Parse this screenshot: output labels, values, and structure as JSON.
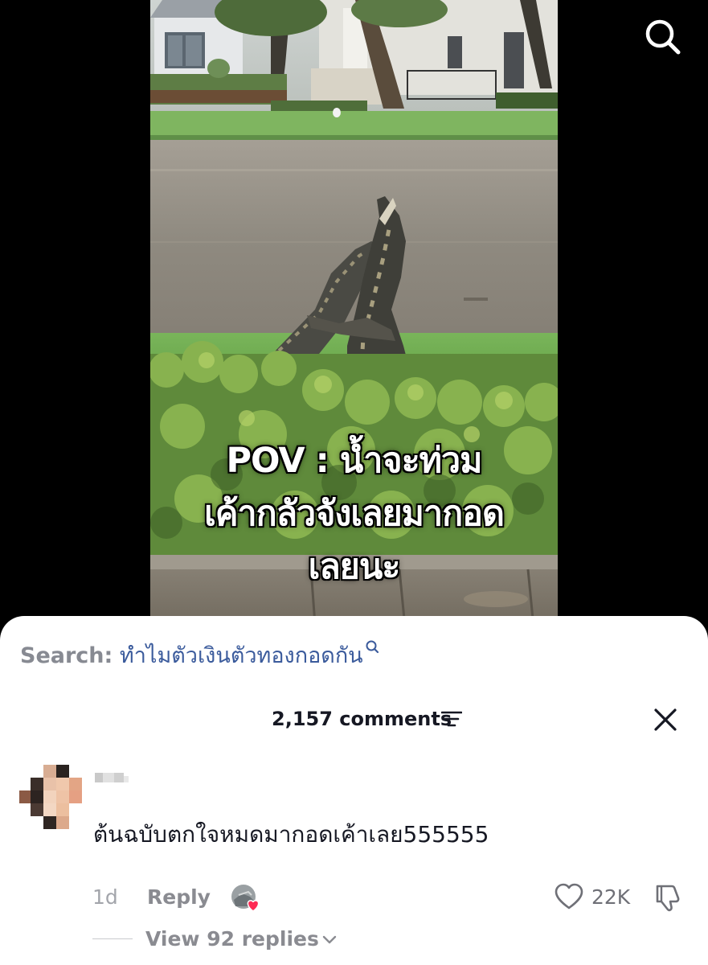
{
  "video": {
    "caption_lines": [
      "POV : น้ำจะท่วม",
      "เค้ากลัวจังเลยมากอด",
      "เลยนะ"
    ]
  },
  "top_bar": {
    "search_icon": "search-icon"
  },
  "search_suggestion": {
    "prefix": "Search:",
    "query": "ทำไมตัวเงินตัวทองกอดกัน",
    "icon": "small-search-icon"
  },
  "comments_header": {
    "count_label": "2,157 comments",
    "filter_icon": "filter-icon",
    "close_icon": "close-icon"
  },
  "comment": {
    "text": "ต้นฉบับตกใจหมดมากอดเค้าเลย555555",
    "time": "1d",
    "reply_label": "Reply",
    "likes": "22K",
    "liked_by_creator": true,
    "view_replies_label": "View 92 replies"
  },
  "colors": {
    "sheet_bg": "#ffffff",
    "primary_text": "#161823",
    "muted_text": "#8a8b91",
    "search_link": "#3b5b9c",
    "heart_accent": "#fe2c55"
  }
}
